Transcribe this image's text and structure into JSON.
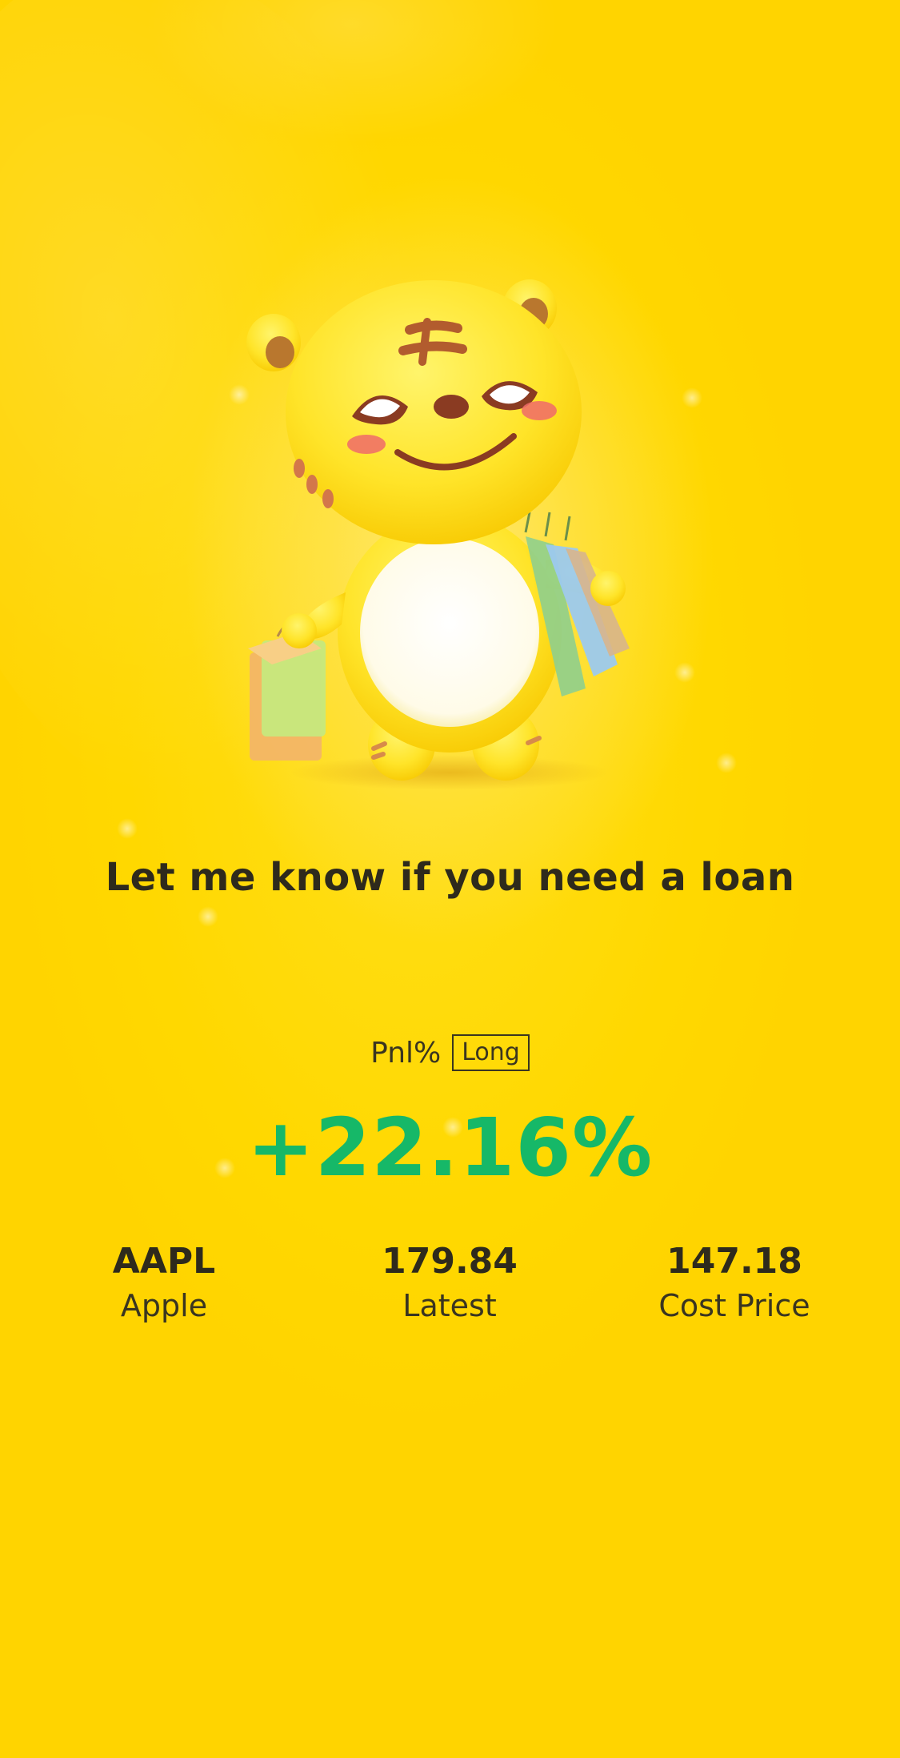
{
  "mascot": {
    "icon": "tiger-mascot-shopping-icon"
  },
  "tagline": "Let me know if you need a loan",
  "pnl": {
    "label": "Pnl%",
    "position_badge": "Long",
    "value": "+22.16%",
    "value_color": "#16b868"
  },
  "stats": [
    {
      "value": "AAPL",
      "label": "Apple"
    },
    {
      "value": "179.84",
      "label": "Latest"
    },
    {
      "value": "147.18",
      "label": "Cost Price"
    }
  ],
  "theme": {
    "background": "#ffd600",
    "text": "#2e2a1c"
  }
}
